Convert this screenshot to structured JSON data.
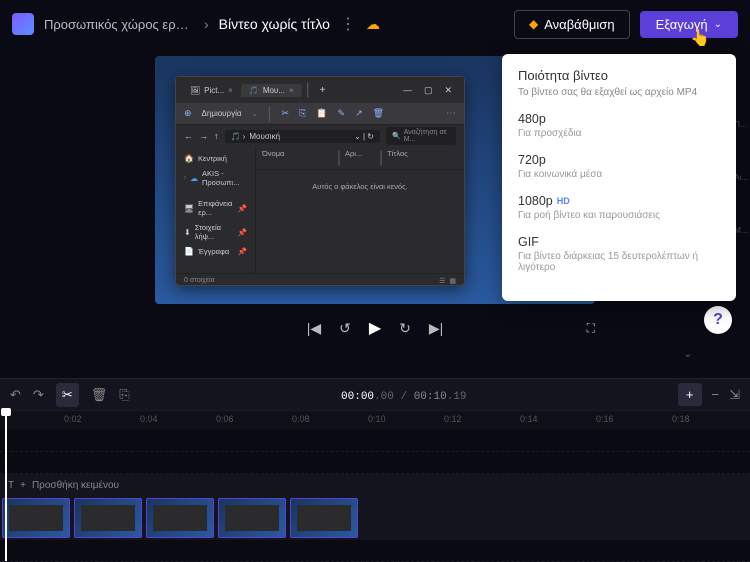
{
  "topbar": {
    "workspace": "Προσωπικός χώρος εργα...",
    "title": "Βίντεο χωρίς τίτλο",
    "upgrade": "Αναβάθμιση",
    "export": "Εξαγωγή"
  },
  "export_menu": {
    "title": "Ποιότητα βίντεο",
    "subtitle": "Το βίντεο σας θα εξαχθεί ως αρχείο MP4",
    "items": [
      {
        "label": "480p",
        "desc": "Για προσχέδια",
        "hd": false
      },
      {
        "label": "720p",
        "desc": "Για κοινωνικά μέσα",
        "hd": false
      },
      {
        "label": "1080p",
        "desc": "Για ροή βίντεο και παρουσιάσεις",
        "hd": true
      },
      {
        "label": "GIF",
        "desc": "Για βίντεο διάρκειας 15 δευτερολέπτων ή λιγότερο",
        "hd": false
      }
    ]
  },
  "explorer": {
    "tab1": "Pict...",
    "tab2": "Μου...",
    "create": "Δημιουργία",
    "location": "Μουσική",
    "search_placeholder": "Αναζήτηση σε Μ...",
    "sidebar": {
      "home": "Κεντρική",
      "user": "AKIS - Προσωπι...",
      "desktop": "Επιφάνεια ερ...",
      "downloads": "Στοιχεία λήψ...",
      "documents": "Έγγραφα"
    },
    "cols": {
      "name": "Όνομα",
      "ar": "Αρι...",
      "title": "Τίτλος"
    },
    "empty": "Αυτός ο φάκελος είναι κενός.",
    "status": "0 στοιχεία"
  },
  "timecode": {
    "current": "00:00",
    "ms": ".00",
    "duration": "00:10",
    "dms": ".19"
  },
  "ruler": [
    "0:02",
    "0:04",
    "0:06",
    "0:08",
    "0:10",
    "0:12",
    "0:14",
    "0:16",
    "0:18"
  ],
  "text_track": "Προσθήκη κειμένου",
  "right_labels": [
    "Π...",
    "Αι...",
    "Μ..."
  ],
  "hd_label": "HD"
}
